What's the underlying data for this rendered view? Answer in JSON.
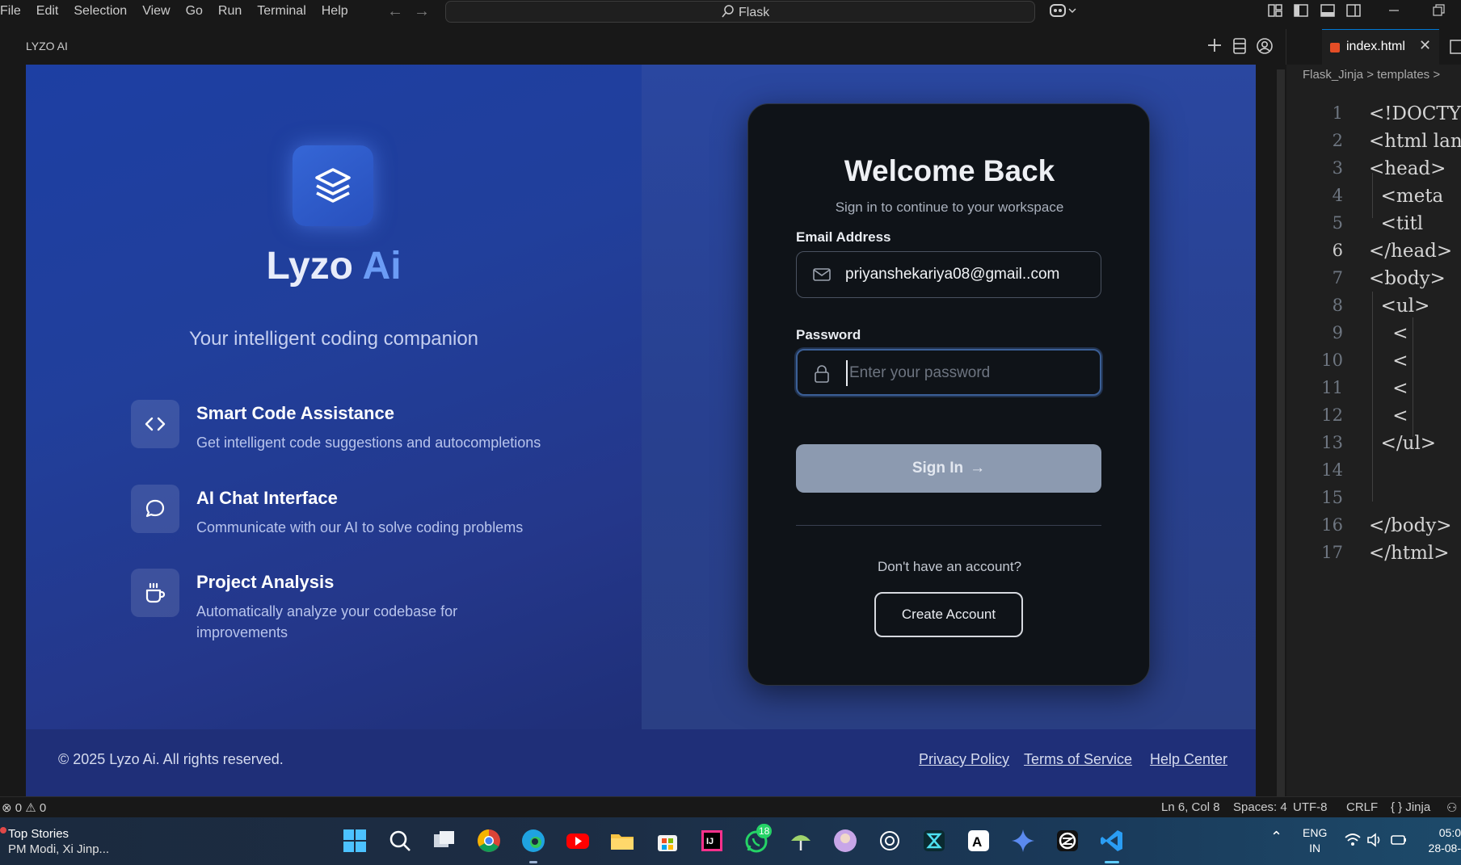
{
  "menubar": {
    "items": [
      "File",
      "Edit",
      "Selection",
      "View",
      "Go",
      "Run",
      "Terminal",
      "Help"
    ],
    "search_text": "Flask"
  },
  "panel": {
    "title": "LYZO AI"
  },
  "app": {
    "brand_main": "Lyzo ",
    "brand_accent": "Ai",
    "tagline": "Your intelligent coding companion",
    "features": [
      {
        "icon": "code-icon",
        "title": "Smart Code Assistance",
        "desc": "Get intelligent code suggestions and autocompletions"
      },
      {
        "icon": "chat-icon",
        "title": "AI Chat Interface",
        "desc": "Communicate with our AI to solve coding problems"
      },
      {
        "icon": "coffee-icon",
        "title": "Project Analysis",
        "desc": "Automatically analyze your codebase for improvements"
      }
    ],
    "login": {
      "title": "Welcome Back",
      "subtitle": "Sign in to continue to your workspace",
      "email_label": "Email Address",
      "email_value": "priyanshekariya08@gmail..com",
      "password_label": "Password",
      "password_placeholder": "Enter your password",
      "signin_label": "Sign In",
      "no_account": "Don't have an account?",
      "create_label": "Create Account"
    },
    "footer": {
      "copyright": "© 2025 Lyzo Ai. All rights reserved.",
      "links": [
        "Privacy Policy",
        "Terms of Service",
        "Help Center"
      ]
    },
    "colors": {
      "accent": "#6b9cf5",
      "card_bg": "#0f1318",
      "button_disabled": "#8c9ab0"
    }
  },
  "editor": {
    "tab_name": "index.html",
    "breadcrumb": "Flask_Jinja > templates >",
    "active_line": 6,
    "lines": [
      {
        "n": "1",
        "code": "<!DOCTYPE"
      },
      {
        "n": "2",
        "code": "<html lan"
      },
      {
        "n": "3",
        "code": "<head>"
      },
      {
        "n": "4",
        "code": "  <meta"
      },
      {
        "n": "5",
        "code": "  <titl"
      },
      {
        "n": "6",
        "code": "</head>"
      },
      {
        "n": "7",
        "code": "<body>"
      },
      {
        "n": "8",
        "code": "  <ul>"
      },
      {
        "n": "9",
        "code": "    <"
      },
      {
        "n": "10",
        "code": "    <"
      },
      {
        "n": "11",
        "code": "    <"
      },
      {
        "n": "12",
        "code": "    <"
      },
      {
        "n": "13",
        "code": "  </ul>"
      },
      {
        "n": "14",
        "code": ""
      },
      {
        "n": "15",
        "code": ""
      },
      {
        "n": "16",
        "code": "</body>"
      },
      {
        "n": "17",
        "code": "</html>"
      }
    ]
  },
  "statusbar": {
    "errors": "0",
    "warnings": "0",
    "position": "Ln 6, Col 8",
    "spaces": "Spaces: 4",
    "encoding": "UTF-8",
    "eol": "CRLF",
    "language": "{ } Jinja"
  },
  "taskbar": {
    "news_title": "Top Stories",
    "news_sub": "PM Modi, Xi Jinp...",
    "whatsapp_badge": "18",
    "lang_top": "ENG",
    "lang_bottom": "IN",
    "time": "05:0",
    "date": "28-08-"
  }
}
